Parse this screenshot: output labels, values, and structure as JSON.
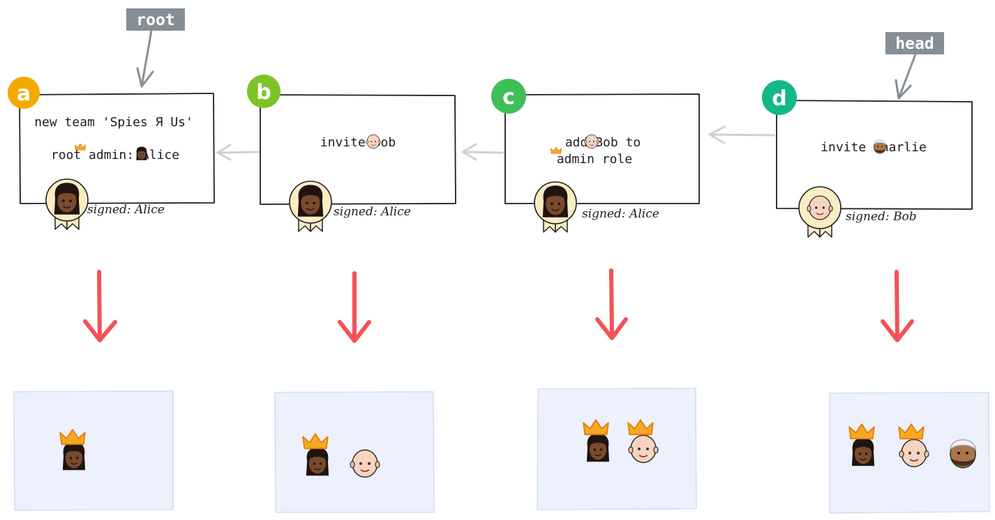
{
  "markers": {
    "root": "root",
    "head": "head"
  },
  "colors": {
    "badge_a": "#f5a800",
    "badge_b": "#7cc427",
    "badge_c": "#3fbf57",
    "badge_d": "#12b886",
    "red_arrow": "#f25257",
    "marker_bg": "#868e96",
    "state_bg": "#edf0fd",
    "state_border": "#d8dcf2",
    "seal_fill": "#faedc4",
    "crown": "#f7a823",
    "skin_alice": "#7a4a2c",
    "skin_bob": "#f7d4c0",
    "skin_charlie": "#a9774b"
  },
  "links": [
    {
      "id": "a",
      "label": "a",
      "lines": [
        "new team 'Spies Я Us'",
        "root admin: Alice"
      ],
      "mentions": [
        "root-crown-icon",
        "alice-face-icon"
      ],
      "signature": "signed: Alice",
      "signer": "Alice"
    },
    {
      "id": "b",
      "label": "b",
      "lines": [
        "invite Bob"
      ],
      "mentions": [
        "bob-face-icon"
      ],
      "signature": "signed: Alice",
      "signer": "Alice"
    },
    {
      "id": "c",
      "label": "c",
      "lines": [
        "add Bob to",
        "admin role"
      ],
      "mentions": [
        "bob-face-icon",
        "admin-crown-icon"
      ],
      "signature": "signed: Alice",
      "signer": "Alice"
    },
    {
      "id": "d",
      "label": "d",
      "lines": [
        "invite Charlie"
      ],
      "mentions": [
        "charlie-face-icon"
      ],
      "signature": "signed: Bob",
      "signer": "Bob"
    }
  ],
  "states": [
    {
      "members": [
        {
          "person": "Alice",
          "admin": true
        }
      ]
    },
    {
      "members": [
        {
          "person": "Alice",
          "admin": true
        },
        {
          "person": "Bob",
          "admin": false
        }
      ]
    },
    {
      "members": [
        {
          "person": "Alice",
          "admin": true
        },
        {
          "person": "Bob",
          "admin": true
        }
      ]
    },
    {
      "members": [
        {
          "person": "Alice",
          "admin": true
        },
        {
          "person": "Bob",
          "admin": true
        },
        {
          "person": "Charlie",
          "admin": false
        }
      ]
    }
  ]
}
